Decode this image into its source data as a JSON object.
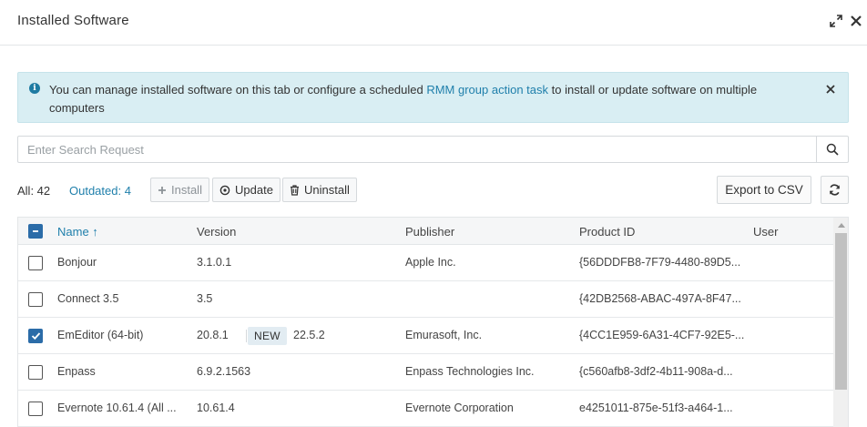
{
  "header": {
    "title": "Installed Software",
    "expand_icon": "expand-arrows-icon",
    "close_icon": "close-icon"
  },
  "info_banner": {
    "text_before": "You can manage installed software on this tab or configure a scheduled ",
    "link_text": "RMM group action task",
    "text_after": " to install or update software on multiple computers",
    "icon": "info-circle-icon"
  },
  "search": {
    "placeholder": "Enter Search Request",
    "value": ""
  },
  "toolbar": {
    "all_label": "All: 42",
    "outdated_label": "Outdated: 4",
    "install_label": "Install",
    "update_label": "Update",
    "uninstall_label": "Uninstall",
    "export_label": "Export to CSV"
  },
  "table": {
    "columns": {
      "name": "Name ↑",
      "version": "Version",
      "publisher": "Publisher",
      "product_id": "Product ID",
      "user": "User"
    },
    "rows": [
      {
        "name": "Bonjour",
        "version": "3.1.0.1",
        "new_badge": "",
        "new_version": "",
        "publisher": "Apple Inc.",
        "product_id": "{56DDDFB8-7F79-4480-89D5...",
        "user": "",
        "checked": false
      },
      {
        "name": "Connect 3.5",
        "version": "3.5",
        "new_badge": "",
        "new_version": "",
        "publisher": "",
        "product_id": "{42DB2568-ABAC-497A-8F47...",
        "user": "",
        "checked": false
      },
      {
        "name": "EmEditor (64-bit)",
        "version": "20.8.1",
        "new_badge": "NEW",
        "new_version": "22.5.2",
        "publisher": "Emurasoft, Inc.",
        "product_id": "{4CC1E959-6A31-4CF7-92E5-...",
        "user": "",
        "checked": true
      },
      {
        "name": "Enpass",
        "version": "6.9.2.1563",
        "new_badge": "",
        "new_version": "",
        "publisher": "Enpass Technologies Inc.",
        "product_id": "{c560afb8-3df2-4b11-908a-d...",
        "user": "",
        "checked": false
      },
      {
        "name": "Evernote 10.61.4 (All ...",
        "version": "10.61.4",
        "new_badge": "",
        "new_version": "",
        "publisher": "Evernote Corporation",
        "product_id": "e4251011-875e-51f3-a464-1...",
        "user": "",
        "checked": false
      }
    ]
  },
  "colors": {
    "accent": "#1f7fab",
    "banner_bg": "#d9eef3",
    "checkbox_checked": "#2b6ca8"
  }
}
